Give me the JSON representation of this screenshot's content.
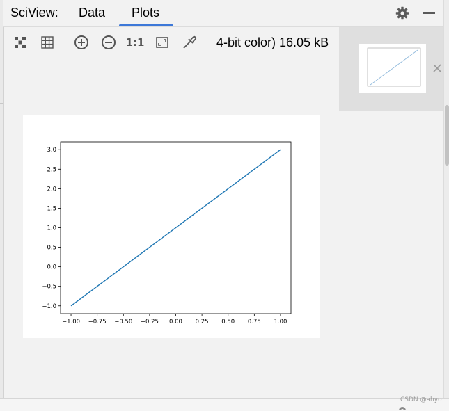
{
  "header": {
    "title": "SciView:",
    "tabs": [
      {
        "label": "Data",
        "active": false
      },
      {
        "label": "Plots",
        "active": true
      }
    ]
  },
  "toolbar": {
    "image_info": "4-bit color) 16.05 kB",
    "buttons": [
      "checker-icon",
      "grid-icon",
      "zoom-in-icon",
      "zoom-out-icon",
      "actual-size-icon",
      "fit-icon",
      "color-picker-icon"
    ],
    "actual_size_label": "1:1"
  },
  "colors": {
    "accent": "#3d78d8",
    "line": "#1f77b4",
    "background": "#f2f2f2"
  },
  "watermark": "CSDN @ahyo",
  "chart_data": {
    "type": "line",
    "title": "",
    "xlabel": "",
    "ylabel": "",
    "xlim": [
      -1.1,
      1.1
    ],
    "ylim": [
      -1.2,
      3.2
    ],
    "xticks": [
      "-1.00",
      "-0.75",
      "-0.50",
      "-0.25",
      "0.00",
      "0.25",
      "0.50",
      "0.75",
      "1.00"
    ],
    "yticks": [
      "-1.0",
      "-0.5",
      "0.0",
      "0.5",
      "1.0",
      "1.5",
      "2.0",
      "2.5",
      "3.0"
    ],
    "series": [
      {
        "x": [
          -1.0,
          1.0
        ],
        "y": [
          -1.0,
          3.0
        ]
      }
    ],
    "grid": false
  }
}
